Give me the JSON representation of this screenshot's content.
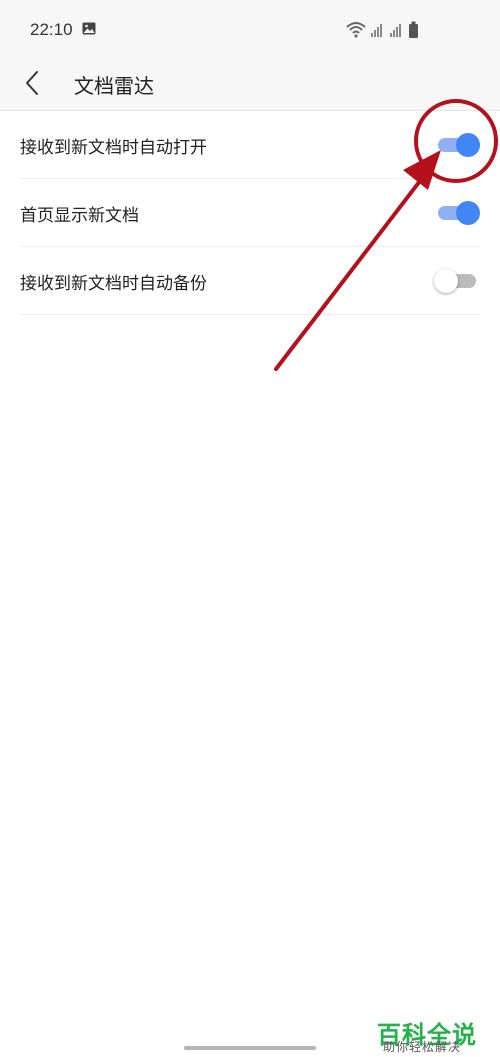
{
  "status_bar": {
    "time": "22:10",
    "icons": [
      "gallery-icon",
      "wifi-icon",
      "signal-icon",
      "signal-icon",
      "battery-icon"
    ]
  },
  "header": {
    "title": "文档雷达",
    "back_icon": "chevron-left-icon"
  },
  "settings": [
    {
      "label": "接收到新文档时自动打开",
      "enabled": true
    },
    {
      "label": "首页显示新文档",
      "enabled": true
    },
    {
      "label": "接收到新文档时自动备份",
      "enabled": false
    }
  ],
  "colors": {
    "toggle_on_thumb": "#4285f4",
    "toggle_on_track": "#8fb1f3",
    "toggle_off_track": "#bbbbbb",
    "annotation": "#b3121d",
    "watermark": "#22b14c"
  },
  "watermark": {
    "title": "百科全说",
    "subtitle": "助你轻松解决"
  }
}
